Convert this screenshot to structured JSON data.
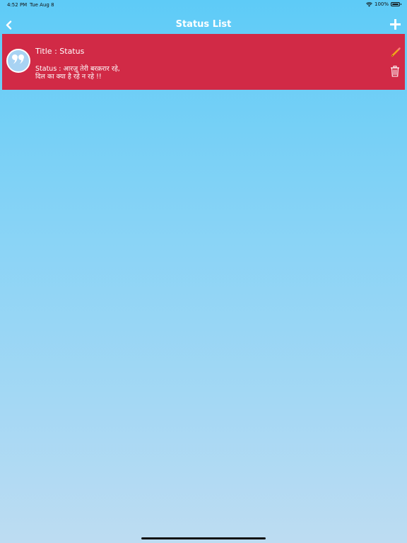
{
  "status_bar": {
    "time": "4:52 PM",
    "date": "Tue Aug 8",
    "battery": "100%"
  },
  "nav": {
    "title": "Status List",
    "back_icon": "chevron-left-icon",
    "add_icon": "plus-icon"
  },
  "statuses": [
    {
      "title": "Title : Status",
      "body": "Status : आरज़ू तेरी बरक़रार रहे,\nदिल का क्या है रहे न रहे !!",
      "avatar_icon": "quote-icon",
      "edit_icon": "pencil-icon",
      "delete_icon": "trash-icon"
    }
  ],
  "colors": {
    "card_background": "#d12a46",
    "avatar_background": "#a8d3f3",
    "pencil": "#f2a51b",
    "gradient_top": "#5ecbf7",
    "gradient_bottom": "#bddcf2"
  }
}
